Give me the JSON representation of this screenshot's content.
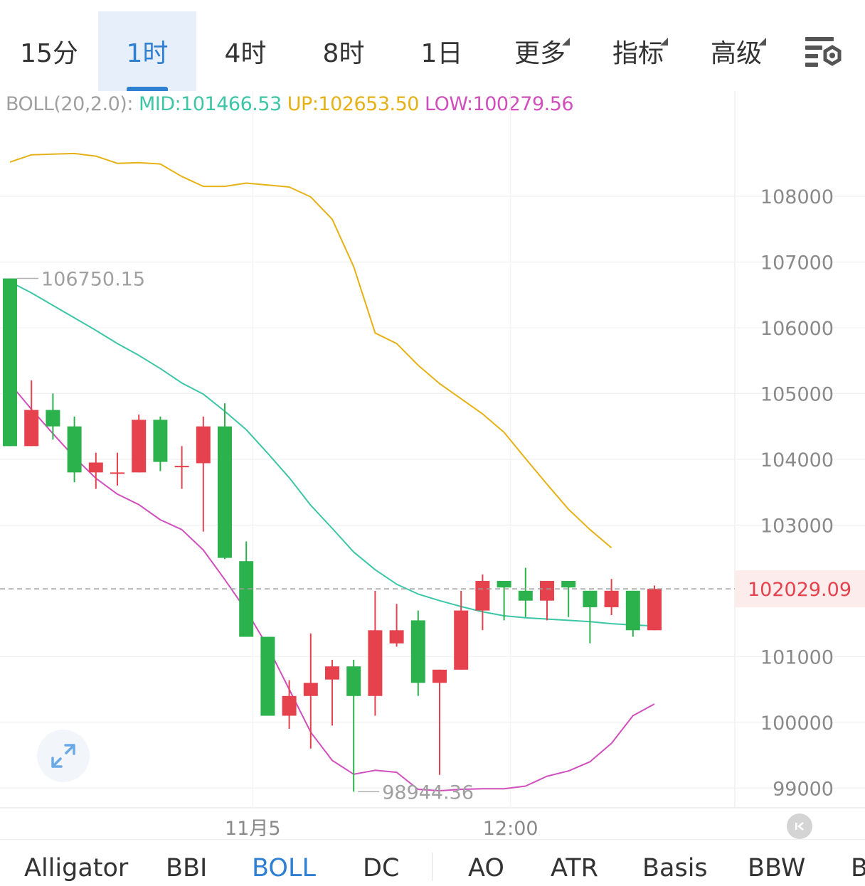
{
  "timeframes": [
    {
      "label": "15分",
      "active": false,
      "dropdown": false
    },
    {
      "label": "1时",
      "active": true,
      "dropdown": false
    },
    {
      "label": "4时",
      "active": false,
      "dropdown": false
    },
    {
      "label": "8时",
      "active": false,
      "dropdown": false
    },
    {
      "label": "1日",
      "active": false,
      "dropdown": false
    },
    {
      "label": "更多",
      "active": false,
      "dropdown": true
    },
    {
      "label": "指标",
      "active": false,
      "dropdown": true
    },
    {
      "label": "高级",
      "active": false,
      "dropdown": true
    }
  ],
  "settings_icon": "chart-settings-icon",
  "boll_legend": {
    "name": "BOLL(20,2.0):",
    "mid": "MID:101466.53",
    "up": "UP:102653.50",
    "low": "LOW:100279.56"
  },
  "colors": {
    "up_candle": "#e5424d",
    "down_candle": "#2bb24c",
    "mid_line": "#3cc6a6",
    "upper_band": "#e6b115",
    "lower_band": "#d14fbd",
    "active_tab": "#2f7fd2",
    "price_tag_bg": "#fdecec"
  },
  "chart_data": {
    "type": "candlestick",
    "y_ticks": [
      "108000",
      "107000",
      "106000",
      "105000",
      "104000",
      "103000",
      "101000",
      "100000",
      "99000"
    ],
    "x_ticks": [
      "11月5",
      "12:00"
    ],
    "ylim": [
      98700,
      109600
    ],
    "current_price": "102029.09",
    "max_label": "106750.15",
    "min_label": "98944.36",
    "candles": [
      {
        "o": 106750,
        "h": 106750,
        "l": 104200,
        "c": 104200
      },
      {
        "o": 104200,
        "h": 105200,
        "l": 104200,
        "c": 104750
      },
      {
        "o": 104750,
        "h": 105000,
        "l": 104300,
        "c": 104500
      },
      {
        "o": 104500,
        "h": 104650,
        "l": 103650,
        "c": 103800
      },
      {
        "o": 103800,
        "h": 104100,
        "l": 103550,
        "c": 103950
      },
      {
        "o": 103800,
        "h": 104100,
        "l": 103600,
        "c": 103800
      },
      {
        "o": 103800,
        "h": 104680,
        "l": 103800,
        "c": 104600
      },
      {
        "o": 104600,
        "h": 104650,
        "l": 103820,
        "c": 103960
      },
      {
        "o": 103900,
        "h": 104200,
        "l": 103550,
        "c": 103900
      },
      {
        "o": 103940,
        "h": 104650,
        "l": 102900,
        "c": 104500
      },
      {
        "o": 104500,
        "h": 104850,
        "l": 102480,
        "c": 102500
      },
      {
        "o": 102450,
        "h": 102750,
        "l": 101300,
        "c": 101300
      },
      {
        "o": 101300,
        "h": 101300,
        "l": 100100,
        "c": 100100
      },
      {
        "o": 100100,
        "h": 100640,
        "l": 99900,
        "c": 100400
      },
      {
        "o": 100400,
        "h": 101350,
        "l": 99600,
        "c": 100600
      },
      {
        "o": 100650,
        "h": 100950,
        "l": 99950,
        "c": 100850
      },
      {
        "o": 100850,
        "h": 100950,
        "l": 98944,
        "c": 100400
      },
      {
        "o": 100400,
        "h": 102000,
        "l": 100100,
        "c": 101400
      },
      {
        "o": 101200,
        "h": 101800,
        "l": 101150,
        "c": 101400
      },
      {
        "o": 101550,
        "h": 101700,
        "l": 100400,
        "c": 100600
      },
      {
        "o": 100600,
        "h": 100800,
        "l": 99200,
        "c": 100800
      },
      {
        "o": 100800,
        "h": 102000,
        "l": 100800,
        "c": 101700
      },
      {
        "o": 101700,
        "h": 102250,
        "l": 101400,
        "c": 102150
      },
      {
        "o": 102150,
        "h": 102150,
        "l": 101550,
        "c": 102050
      },
      {
        "o": 102000,
        "h": 102350,
        "l": 101600,
        "c": 101850
      },
      {
        "o": 101850,
        "h": 102150,
        "l": 101550,
        "c": 102150
      },
      {
        "o": 102150,
        "h": 102150,
        "l": 101600,
        "c": 102050
      },
      {
        "o": 102000,
        "h": 102000,
        "l": 101200,
        "c": 101750
      },
      {
        "o": 101750,
        "h": 102180,
        "l": 101630,
        "c": 102000
      },
      {
        "o": 102000,
        "h": 102000,
        "l": 101300,
        "c": 101400
      },
      {
        "o": 101400,
        "h": 102080,
        "l": 101400,
        "c": 102029
      }
    ],
    "mid_line": [
      106700,
      106530,
      106340,
      106150,
      105960,
      105760,
      105580,
      105380,
      105160,
      104990,
      104730,
      104450,
      104090,
      103720,
      103300,
      102950,
      102590,
      102320,
      102100,
      101950,
      101850,
      101760,
      101680,
      101620,
      101590,
      101570,
      101550,
      101530,
      101500,
      101480,
      101466
    ],
    "upper_band": [
      108520,
      108630,
      108640,
      108650,
      108610,
      108500,
      108510,
      108490,
      108300,
      108150,
      108150,
      108200,
      108170,
      108140,
      107990,
      107650,
      106930,
      105920,
      105760,
      105430,
      105150,
      104920,
      104690,
      104410,
      104010,
      103620,
      103240,
      102930,
      102653
    ],
    "lower_band": [
      105150,
      104760,
      104390,
      104030,
      103710,
      103470,
      103310,
      103080,
      102930,
      102620,
      102170,
      101700,
      101150,
      100500,
      99850,
      99420,
      99210,
      99270,
      99240,
      98980,
      98960,
      98980,
      98990,
      98990,
      99030,
      99180,
      99260,
      99400,
      99680,
      100100,
      100279
    ]
  },
  "indicators": [
    {
      "label": "Alligator",
      "active": false
    },
    {
      "label": "BBI",
      "active": false
    },
    {
      "label": "BOLL",
      "active": true
    },
    {
      "label": "DC",
      "active": false
    },
    {
      "label": "AO",
      "active": false
    },
    {
      "label": "ATR",
      "active": false
    },
    {
      "label": "Basis",
      "active": false
    },
    {
      "label": "BBW",
      "active": false
    },
    {
      "label": "B",
      "active": false
    }
  ]
}
